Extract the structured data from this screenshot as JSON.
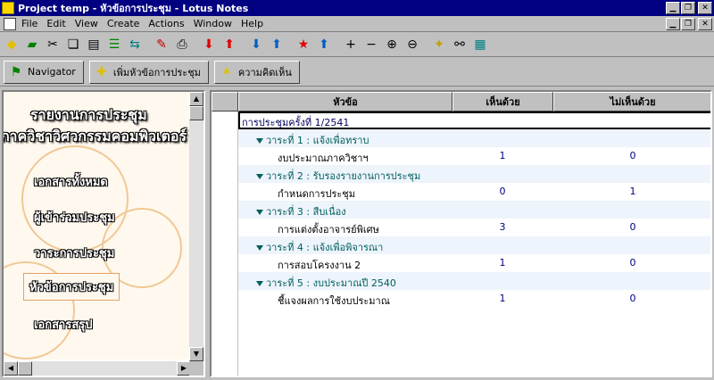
{
  "window": {
    "title": "Project temp - หัวข้อการประชุม - Lotus Notes"
  },
  "menu": [
    "File",
    "Edit",
    "View",
    "Create",
    "Actions",
    "Window",
    "Help"
  ],
  "toolbar_icons": [
    "navigator-diamond-icon",
    "open-book-icon",
    "scissors-icon",
    "copy-doc-icon",
    "paste-doc-icon",
    "sort-icon",
    "link-icon",
    "pen-icon",
    "print-icon",
    "arrow-down-red-icon",
    "arrow-up-red-icon",
    "arrow-down-blue-icon",
    "arrow-up-blue-icon",
    "star-down-icon",
    "star-up-icon",
    "expand-plus-icon",
    "collapse-minus-icon",
    "expand-all-icon",
    "collapse-all-icon",
    "flashlight-icon",
    "search-binoculars-icon",
    "grid-view-icon"
  ],
  "actions": {
    "navigator": "Navigator",
    "add_topic": "เพิ่มหัวข้อการประชุม",
    "comment": "ความคิดเห็น"
  },
  "nav": {
    "title1": "รายงานการประชุม",
    "title2": "ภาควิชาวิศวกรรมคอมพิวเตอร์",
    "links": [
      "เอกสารทั้งหมด",
      "ผู้เข้าร่วมประชุม",
      "วาระการประชุม",
      "หัวข้อการประชุม",
      "เอกสารสรุป"
    ]
  },
  "view": {
    "headers": {
      "topic": "หัวข้อ",
      "agree": "เห็นด้วย",
      "disagree": "ไม่เห็นด้วย"
    },
    "top_category": "การประชุมครั้งที่ 1/2541",
    "rows": [
      {
        "cat": "วาระที่ 1 : แจ้งเพื่อทราบ",
        "item": "งบประมาณภาควิชาฯ",
        "agree": "1",
        "disagree": "0"
      },
      {
        "cat": "วาระที่ 2 : รับรองรายงานการประชุม",
        "item": "กำหนดการประชุม",
        "agree": "0",
        "disagree": "1"
      },
      {
        "cat": "วาระที่ 3 : สืบเนื่อง",
        "item": "การแต่งตั้งอาจารย์พิเศษ",
        "agree": "3",
        "disagree": "0"
      },
      {
        "cat": "วาระที่ 4 : แจ้งเพื่อพิจารณา",
        "item": "การสอบโครงงาน 2",
        "agree": "1",
        "disagree": "0"
      },
      {
        "cat": "วาระที่ 5 : งบประมาณปี 2540",
        "item": "ชี้แจงผลการใช้งบประมาณ",
        "agree": "1",
        "disagree": "0"
      }
    ]
  }
}
